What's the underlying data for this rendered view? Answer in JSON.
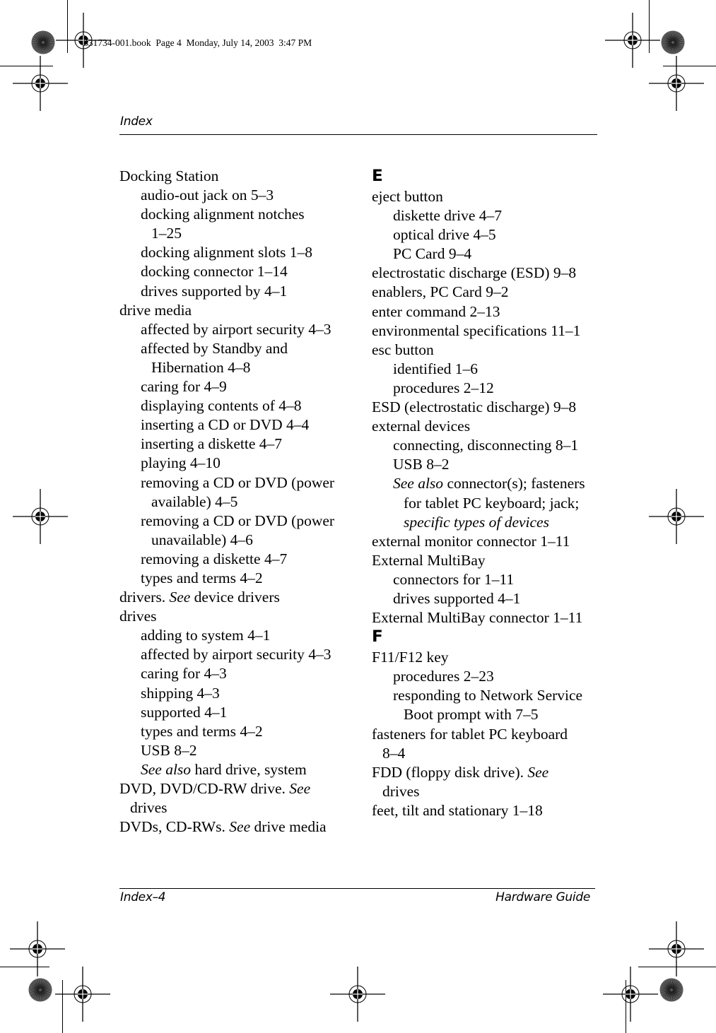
{
  "slug": "331734-001.book  Page 4  Monday, July 14, 2003  3:47 PM",
  "header": {
    "running_head": "Index"
  },
  "footer": {
    "page_label": "Index–4",
    "book_title": "Hardware Guide"
  },
  "left_column": [
    {
      "level": 1,
      "text": "Docking Station"
    },
    {
      "level": 2,
      "text": "audio-out jack on 5–3"
    },
    {
      "level": 2,
      "text": "docking alignment notches"
    },
    {
      "level": "2c",
      "text": "1–25"
    },
    {
      "level": 2,
      "text": "docking alignment slots 1–8"
    },
    {
      "level": 2,
      "text": "docking connector 1–14"
    },
    {
      "level": 2,
      "text": "drives supported by 4–1"
    },
    {
      "level": 1,
      "text": "drive media"
    },
    {
      "level": 2,
      "text": "affected by airport security 4–3"
    },
    {
      "level": 2,
      "text": "affected by Standby and"
    },
    {
      "level": "2c",
      "text": "Hibernation 4–8"
    },
    {
      "level": 2,
      "text": "caring for 4–9"
    },
    {
      "level": 2,
      "text": "displaying contents of 4–8"
    },
    {
      "level": 2,
      "text": "inserting a CD or DVD 4–4"
    },
    {
      "level": 2,
      "text": "inserting a diskette 4–7"
    },
    {
      "level": 2,
      "text": "playing 4–10"
    },
    {
      "level": 2,
      "text": "removing a CD or DVD (power"
    },
    {
      "level": "2c",
      "text": "available) 4–5"
    },
    {
      "level": 2,
      "text": "removing a CD or DVD (power"
    },
    {
      "level": "2c",
      "text": "unavailable) 4–6"
    },
    {
      "level": 2,
      "text": "removing a diskette 4–7"
    },
    {
      "level": 2,
      "text": "types and terms 4–2"
    },
    {
      "level": 1,
      "pre": "drivers. ",
      "italic": "See",
      "post": " device drivers"
    },
    {
      "level": 1,
      "text": "drives"
    },
    {
      "level": 2,
      "text": "adding to system 4–1"
    },
    {
      "level": 2,
      "text": "affected by airport security 4–3"
    },
    {
      "level": 2,
      "text": "caring for 4–3"
    },
    {
      "level": 2,
      "text": "shipping 4–3"
    },
    {
      "level": 2,
      "text": "supported 4–1"
    },
    {
      "level": 2,
      "text": "types and terms 4–2"
    },
    {
      "level": 2,
      "text": "USB 8–2"
    },
    {
      "level": 2,
      "pre": "",
      "italic": "See also",
      "post": " hard drive, system"
    },
    {
      "level": 1,
      "pre": "DVD, DVD/CD-RW drive. ",
      "italic": "See",
      "post": ""
    },
    {
      "level": "1c",
      "text": "drives"
    },
    {
      "level": 1,
      "pre": "DVDs, CD-RWs. ",
      "italic": "See",
      "post": " drive media"
    }
  ],
  "right_column": [
    {
      "level": "letter",
      "text": "E"
    },
    {
      "level": 1,
      "text": "eject button"
    },
    {
      "level": 2,
      "text": "diskette drive 4–7"
    },
    {
      "level": 2,
      "text": "optical drive 4–5"
    },
    {
      "level": 2,
      "text": "PC Card 9–4"
    },
    {
      "level": 1,
      "text": "electrostatic discharge (ESD) 9–8"
    },
    {
      "level": 1,
      "text": "enablers, PC Card 9–2"
    },
    {
      "level": 1,
      "text": "enter command 2–13"
    },
    {
      "level": 1,
      "text": "environmental specifications 11–1"
    },
    {
      "level": 1,
      "text": "esc button"
    },
    {
      "level": 2,
      "text": "identified 1–6"
    },
    {
      "level": 2,
      "text": "procedures 2–12"
    },
    {
      "level": 1,
      "text": "ESD (electrostatic discharge) 9–8"
    },
    {
      "level": 1,
      "text": "external devices"
    },
    {
      "level": 2,
      "text": "connecting, disconnecting 8–1"
    },
    {
      "level": 2,
      "text": "USB 8–2"
    },
    {
      "level": 2,
      "pre": "",
      "italic": "See also",
      "post": " connector(s); fasteners"
    },
    {
      "level": "2c",
      "text": "for tablet PC keyboard; jack;"
    },
    {
      "level": "2c",
      "pre": "",
      "italic": "specific types of devices",
      "post": ""
    },
    {
      "level": 1,
      "text": "external monitor connector 1–11"
    },
    {
      "level": 1,
      "text": "External MultiBay"
    },
    {
      "level": 2,
      "text": "connectors for 1–11"
    },
    {
      "level": 2,
      "text": "drives supported 4–1"
    },
    {
      "level": 1,
      "text": "External MultiBay connector 1–11"
    },
    {
      "level": "letter",
      "text": "F"
    },
    {
      "level": 1,
      "text": "F11/F12 key"
    },
    {
      "level": 2,
      "text": "procedures 2–23"
    },
    {
      "level": 2,
      "text": "responding to Network Service"
    },
    {
      "level": "2c",
      "text": "Boot prompt with 7–5"
    },
    {
      "level": 1,
      "text": "fasteners for tablet PC keyboard"
    },
    {
      "level": "1c",
      "text": "8–4"
    },
    {
      "level": 1,
      "pre": "FDD (floppy disk drive). ",
      "italic": "See",
      "post": ""
    },
    {
      "level": "1c",
      "text": "drives"
    },
    {
      "level": 1,
      "text": "feet, tilt and stationary 1–18"
    }
  ],
  "icons": {
    "registration_mark": "registration-crosshair-icon",
    "color_bar": "star-target-icon"
  }
}
